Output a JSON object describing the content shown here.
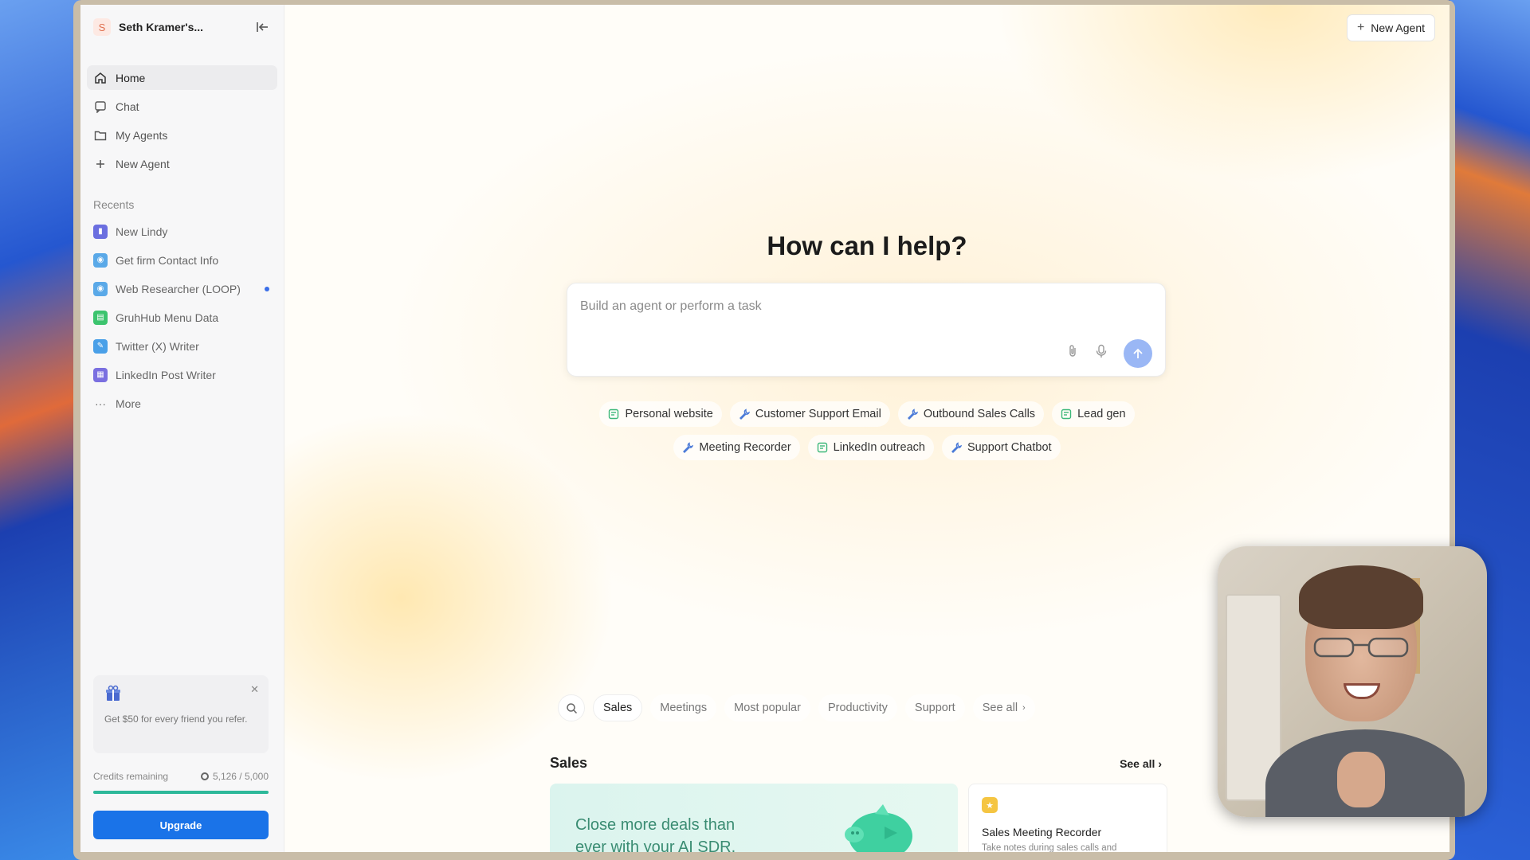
{
  "workspace": {
    "initial": "S",
    "name": "Seth Kramer's..."
  },
  "nav": [
    {
      "label": "Home",
      "icon": "home-icon",
      "active": true
    },
    {
      "label": "Chat",
      "icon": "chat-icon",
      "active": false
    },
    {
      "label": "My Agents",
      "icon": "folder-icon",
      "active": false
    },
    {
      "label": "New Agent",
      "icon": "plus-icon",
      "active": false
    }
  ],
  "recents": {
    "label": "Recents",
    "items": [
      {
        "label": "New Lindy",
        "color": "#6b6fe0"
      },
      {
        "label": "Get firm Contact Info",
        "color": "#5aa9e8"
      },
      {
        "label": "Web Researcher (LOOP)",
        "color": "#5aa9e8",
        "badge": true
      },
      {
        "label": "GruhHub Menu Data",
        "color": "#3cc46e"
      },
      {
        "label": "Twitter (X) Writer",
        "color": "#4aa0e8"
      },
      {
        "label": "LinkedIn Post Writer",
        "color": "#7a6fe0"
      }
    ],
    "more": "More"
  },
  "refer": {
    "text": "Get $50 for every friend you refer."
  },
  "credits": {
    "label": "Credits remaining",
    "value": "5,126 / 5,000",
    "fraction": 1.0
  },
  "upgrade": "Upgrade",
  "top_button": "New Agent",
  "hero": {
    "title": "How can I help?",
    "placeholder": "Build an agent or perform a task"
  },
  "chips_row1": [
    {
      "label": "Personal website",
      "icon": "doc-icon"
    },
    {
      "label": "Customer Support Email",
      "icon": "wrench-icon"
    },
    {
      "label": "Outbound Sales Calls",
      "icon": "wrench-icon"
    },
    {
      "label": "Lead gen",
      "icon": "doc-icon"
    }
  ],
  "chips_row2": [
    {
      "label": "Meeting Recorder",
      "icon": "wrench-icon"
    },
    {
      "label": "LinkedIn outreach",
      "icon": "doc-icon"
    },
    {
      "label": "Support Chatbot",
      "icon": "wrench-icon"
    }
  ],
  "filters": [
    "Sales",
    "Meetings",
    "Most popular",
    "Productivity",
    "Support",
    "See all"
  ],
  "sales_section": {
    "title": "Sales",
    "see_all": "See all",
    "promo": "Close more deals than ever with your AI SDR.",
    "card_title": "Sales Meeting Recorder",
    "card_desc": "Take notes during sales calls and"
  },
  "colors": {
    "accent": "#1a73e8",
    "progress": "#2db89a",
    "send": "#9ab7f5"
  }
}
